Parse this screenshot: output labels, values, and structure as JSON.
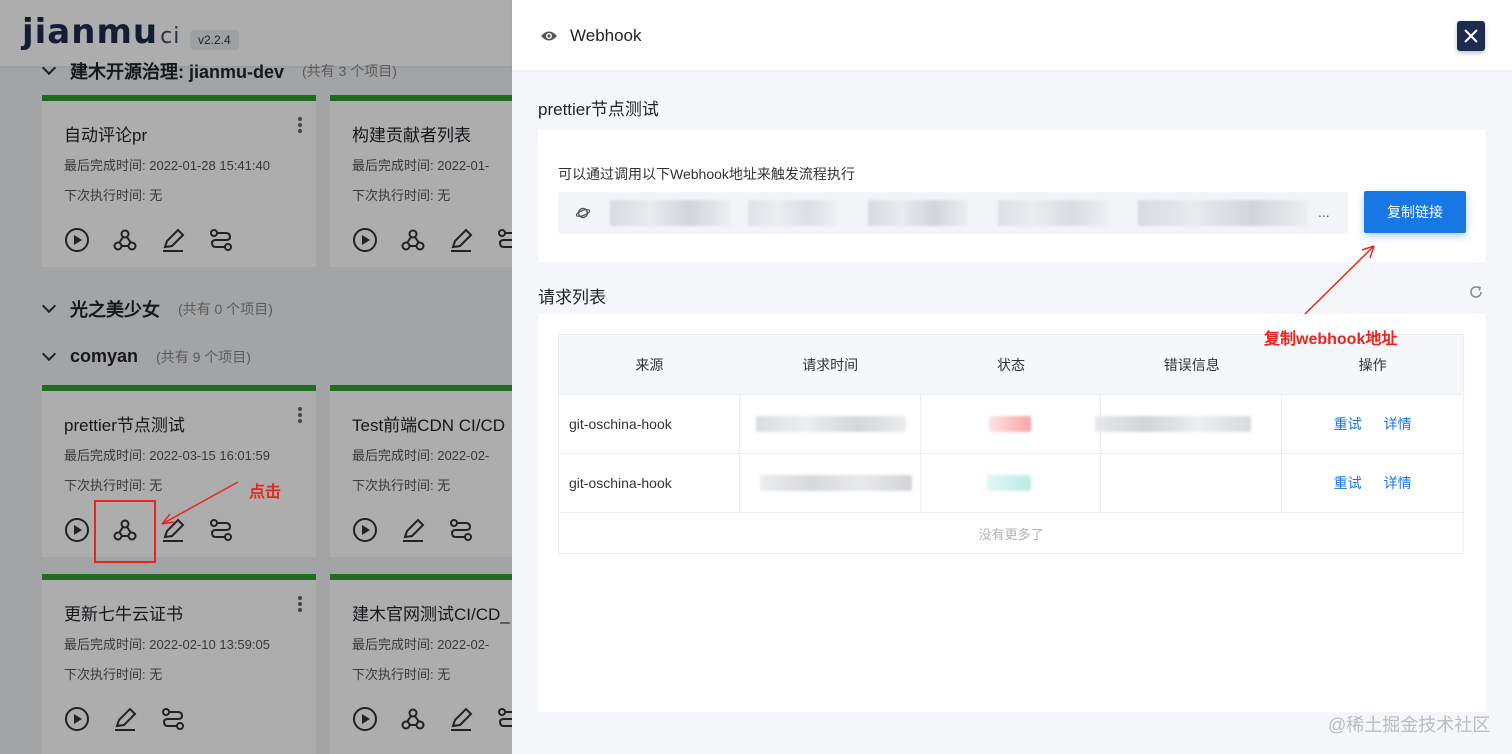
{
  "app": {
    "logo_text": "jianmu",
    "logo_suffix": "ci",
    "version": "v2.2.4"
  },
  "groups": [
    {
      "title": "建木开源治理: jianmu-dev",
      "count": "(共有 3 个项目)"
    },
    {
      "title": "光之美少女",
      "count": "(共有 0 个项目)"
    },
    {
      "title": "comyan",
      "count": "(共有 9 个项目)"
    }
  ],
  "cards": [
    {
      "name": "自动评论pr",
      "last": "最后完成时间: 2022-01-28 15:41:40",
      "next": "下次执行时间: 无"
    },
    {
      "name": "构建贡献者列表",
      "last": "最后完成时间: 2022-01-",
      "next": "下次执行时间: 无"
    },
    {
      "name": "prettier节点测试",
      "last": "最后完成时间: 2022-03-15 16:01:59",
      "next": "下次执行时间: 无"
    },
    {
      "name": "Test前端CDN CI/CD",
      "last": "最后完成时间: 2022-02-",
      "next": "下次执行时间: 无"
    },
    {
      "name": "更新七牛云证书",
      "last": "最后完成时间: 2022-02-10 13:59:05",
      "next": "下次执行时间: 无"
    },
    {
      "name": "建木官网测试CI/CD_",
      "last": "最后完成时间: 2022-02-",
      "next": "下次执行时间: 无"
    }
  ],
  "annotations": {
    "click": "点击",
    "copy_hint": "复制webhook地址"
  },
  "drawer": {
    "title": "Webhook",
    "project_name": "prettier节点测试",
    "url_hint": "可以通过调用以下Webhook地址来触发流程执行",
    "url_ellipsis": "...",
    "copy_button": "复制链接",
    "request_list_title": "请求列表",
    "table": {
      "headers": [
        "来源",
        "请求时间",
        "状态",
        "错误信息",
        "操作"
      ],
      "rows": [
        {
          "source": "git-oschina-hook",
          "retry": "重试",
          "detail": "详情"
        },
        {
          "source": "git-oschina-hook",
          "retry": "重试",
          "detail": "详情"
        }
      ],
      "no_more": "没有更多了"
    }
  },
  "watermark": "@稀土掘金技术社区",
  "colors": {
    "brand": "#1d2b4f",
    "primary": "#1677e5",
    "success": "#2f9e2f",
    "annotation": "#e5271e"
  }
}
